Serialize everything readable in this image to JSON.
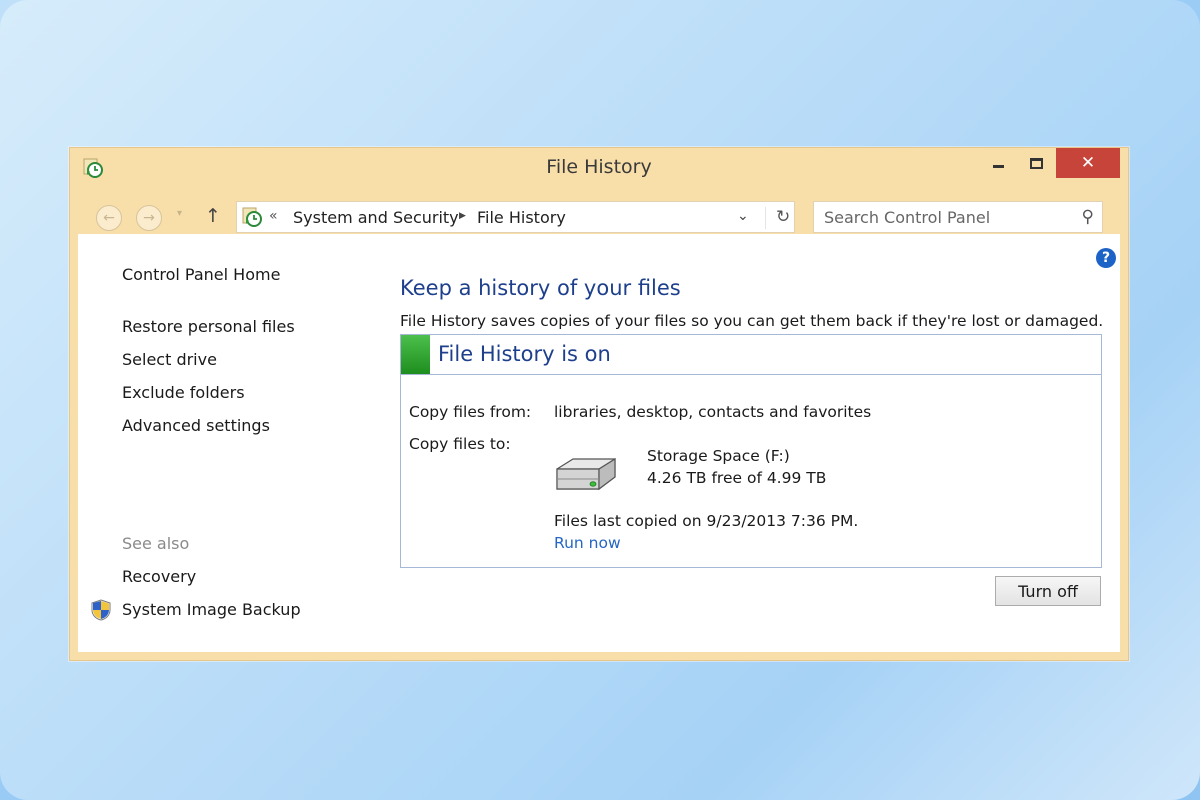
{
  "window": {
    "title": "File History",
    "close_glyph": "✕"
  },
  "navbar": {
    "back_glyph": "←",
    "forward_glyph": "→",
    "dropdown_glyph": "▾",
    "up_glyph": "↑",
    "breadcrumb_prefix": "«",
    "breadcrumb": [
      "System and Security",
      "File History"
    ],
    "breadcrumb_separator": "▶",
    "address_dropdown_glyph": "⌄",
    "refresh_glyph": "↻",
    "search_placeholder": "Search Control Panel",
    "search_glyph": "⚲"
  },
  "help": {
    "glyph": "?"
  },
  "sidebar": {
    "home": "Control Panel Home",
    "links": [
      "Restore personal files",
      "Select drive",
      "Exclude folders",
      "Advanced settings"
    ],
    "see_also_label": "See also",
    "see_also": [
      "Recovery",
      "System Image Backup"
    ]
  },
  "main": {
    "heading": "Keep a history of your files",
    "description": "File History saves copies of your files so you can get them back if they're lost or damaged.",
    "status_title": "File History is on",
    "copy_from_label": "Copy files from:",
    "copy_from_value": "libraries, desktop, contacts and favorites",
    "copy_to_label": "Copy files to:",
    "drive_name": "Storage Space (F:)",
    "drive_free": "4.26 TB free of 4.99 TB",
    "last_copied": "Files last copied on 9/23/2013 7:36 PM.",
    "run_now": "Run now",
    "turn_off": "Turn off"
  },
  "colors": {
    "window_frame": "#f8dea9",
    "close_button": "#c7443a",
    "heading": "#1e3f8c",
    "link": "#2566c4",
    "status_on": "#2ea52e"
  }
}
